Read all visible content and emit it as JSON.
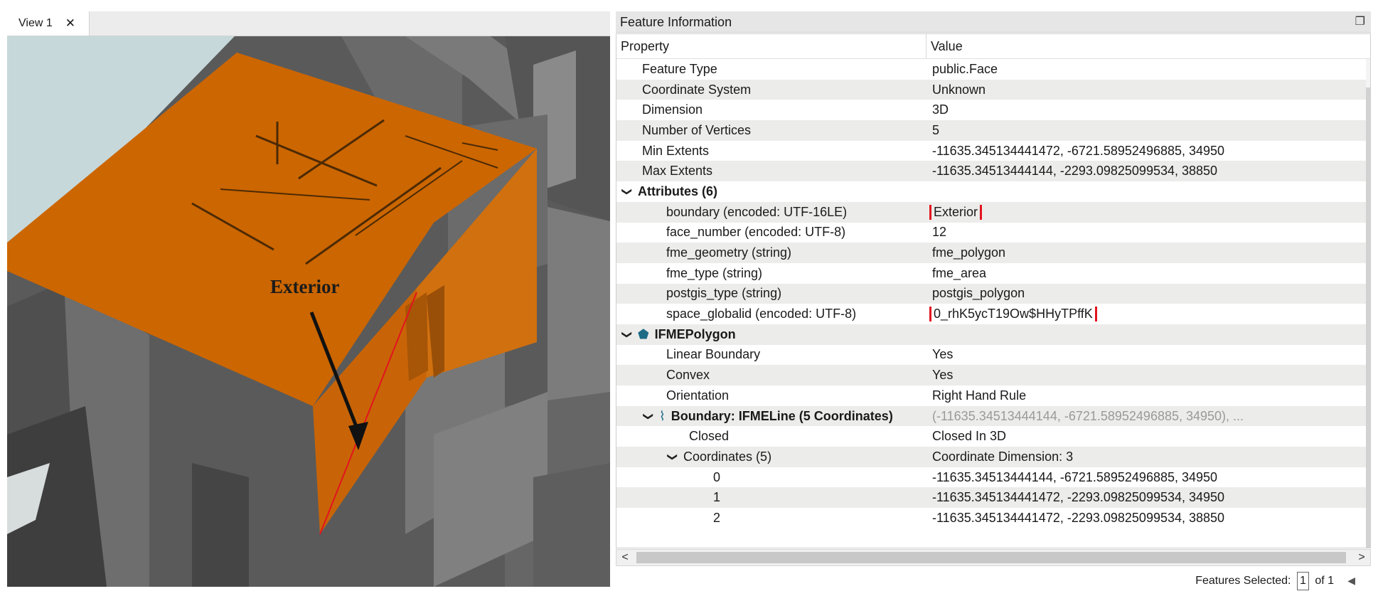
{
  "view_tab": {
    "label": "View 1",
    "close": "✕"
  },
  "viewport": {
    "annotation": "Exterior"
  },
  "panel": {
    "title": "Feature Information",
    "columns": {
      "property": "Property",
      "value": "Value"
    },
    "rows": [
      {
        "label": "Feature Type",
        "value": "public.Face"
      },
      {
        "label": "Coordinate System",
        "value": "Unknown"
      },
      {
        "label": "Dimension",
        "value": "3D"
      },
      {
        "label": "Number of Vertices",
        "value": "5"
      },
      {
        "label": "Min Extents",
        "value": "-11635.345134441472, -6721.58952496885, 34950"
      },
      {
        "label": "Max Extents",
        "value": "-11635.34513444144, -2293.09825099534, 38850"
      },
      {
        "label": "Attributes (6)",
        "value": ""
      },
      {
        "label": "boundary (encoded: UTF-16LE)",
        "value": "Exterior"
      },
      {
        "label": "face_number (encoded: UTF-8)",
        "value": "12"
      },
      {
        "label": "fme_geometry (string)",
        "value": "fme_polygon"
      },
      {
        "label": "fme_type (string)",
        "value": "fme_area"
      },
      {
        "label": "postgis_type (string)",
        "value": "postgis_polygon"
      },
      {
        "label": "space_globalid (encoded: UTF-8)",
        "value": "0_rhK5ycT19Ow$HHyTPffK"
      },
      {
        "label": "IFMEPolygon",
        "value": ""
      },
      {
        "label": "Linear Boundary",
        "value": "Yes"
      },
      {
        "label": "Convex",
        "value": "Yes"
      },
      {
        "label": "Orientation",
        "value": "Right Hand Rule"
      },
      {
        "label": "Boundary: IFMELine (5 Coordinates)",
        "value": "(-11635.34513444144, -6721.58952496885, 34950), ..."
      },
      {
        "label": "Closed",
        "value": "Closed In 3D"
      },
      {
        "label": "Coordinates (5)",
        "value": "Coordinate Dimension: 3"
      },
      {
        "label": "0",
        "value": "-11635.34513444144, -6721.58952496885, 34950"
      },
      {
        "label": "1",
        "value": "-11635.345134441472, -2293.09825099534, 34950"
      },
      {
        "label": "2",
        "value": "-11635.345134441472, -2293.09825099534, 38850"
      }
    ],
    "status": {
      "prefix": "Features Selected:",
      "selected": "1",
      "suffix": "of 1"
    }
  },
  "colors": {
    "highlight": "#e3141e",
    "face": "#cc6600",
    "wall": "#5c5c5c",
    "sky": "#c6d8da"
  }
}
